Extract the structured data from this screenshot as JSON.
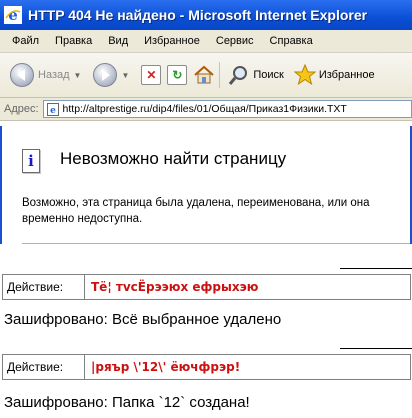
{
  "window": {
    "title": "HTTP 404 Не найдено - Microsoft Internet Explorer"
  },
  "menu": [
    "Файл",
    "Правка",
    "Вид",
    "Избранное",
    "Сервис",
    "Справка"
  ],
  "toolbar": {
    "back_label": "Назад",
    "search_label": "Поиск",
    "favorites_label": "Избранное",
    "icons": [
      "back-arrow-icon",
      "forward-arrow-icon",
      "stop-icon",
      "refresh-icon",
      "home-icon",
      "search-icon",
      "favorites-star-icon"
    ]
  },
  "address": {
    "label": "Адрес:",
    "url": "http://altprestige.ru/dip4/files/01/Общая/Приказ1Физики.TXT"
  },
  "error_page": {
    "heading": "Невозможно найти страницу",
    "body": "Возможно, эта страница была удалена, переименована, или она временно недоступна."
  },
  "actions": [
    {
      "label": "Действие:",
      "value": "Тё¦ тvсЁрээюх ефрыхэю",
      "result": "Зашифровано: Всё выбранное удалено"
    },
    {
      "label": "Действие:",
      "value": "|ряър \\'12\\' ёючфрэр!",
      "result": "Зашифровано: Папка `12` создана!"
    }
  ],
  "colors": {
    "titlebar": "#0a4fd6",
    "action_value": "#cc1111",
    "info_icon": "#1818c8"
  }
}
